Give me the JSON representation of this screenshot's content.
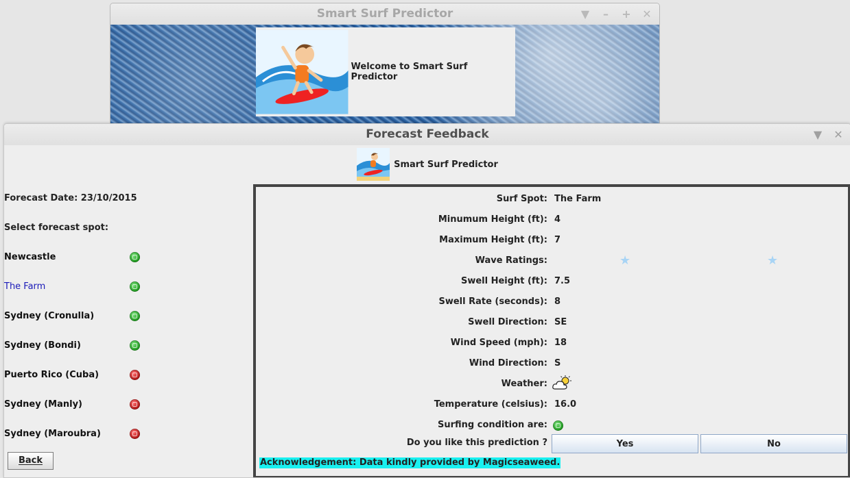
{
  "back_window": {
    "title": "Smart Surf Predictor",
    "welcome_text": "Welcome to Smart Surf Predictor"
  },
  "front_window": {
    "title": "Forecast Feedback",
    "header_title": "Smart Surf Predictor"
  },
  "left": {
    "forecast_date": "Forecast Date: 23/10/2015",
    "select_label": "Select forecast spot:",
    "spots": [
      {
        "name": "Newcastle",
        "status": "green"
      },
      {
        "name": "The Farm",
        "status": "green"
      },
      {
        "name": "Sydney (Cronulla)",
        "status": "green"
      },
      {
        "name": "Sydney (Bondi)",
        "status": "green"
      },
      {
        "name": "Puerto Rico (Cuba)",
        "status": "red"
      },
      {
        "name": "Sydney (Manly)",
        "status": "red"
      },
      {
        "name": "Sydney (Maroubra)",
        "status": "red"
      }
    ],
    "back_label": "Back"
  },
  "details": {
    "rows": [
      {
        "label": "Surf Spot:",
        "value": "The Farm"
      },
      {
        "label": "Minumum Height (ft):",
        "value": "4"
      },
      {
        "label": "Maximum Height (ft):",
        "value": "7"
      },
      {
        "label": "Wave Ratings:",
        "value": ""
      },
      {
        "label": "Swell Height (ft):",
        "value": "7.5"
      },
      {
        "label": "Swell Rate (seconds):",
        "value": "8"
      },
      {
        "label": "Swell Direction:",
        "value": "SE"
      },
      {
        "label": "Wind Speed (mph):",
        "value": "18"
      },
      {
        "label": "Wind Direction:",
        "value": "S"
      },
      {
        "label": "Weather:",
        "value": ""
      },
      {
        "label": "Temperature (celsius):",
        "value": "16.0"
      },
      {
        "label": "Surfing condition are:",
        "value": ""
      },
      {
        "label": "Do you like this prediction ?",
        "value": ""
      }
    ],
    "wave_rating_stars": 2,
    "weather_icon": "cloud-sun-icon",
    "surf_condition_status": "green",
    "yes_label": "Yes",
    "no_label": "No",
    "acknowledgement": "Acknowledgement: Data kindly provided by Magicseaweed."
  },
  "colors": {
    "status_green": "#1e9a1e",
    "status_red": "#b01515",
    "selected_spot": "#1a1ab8",
    "ack_highlight": "#19f0f0"
  }
}
